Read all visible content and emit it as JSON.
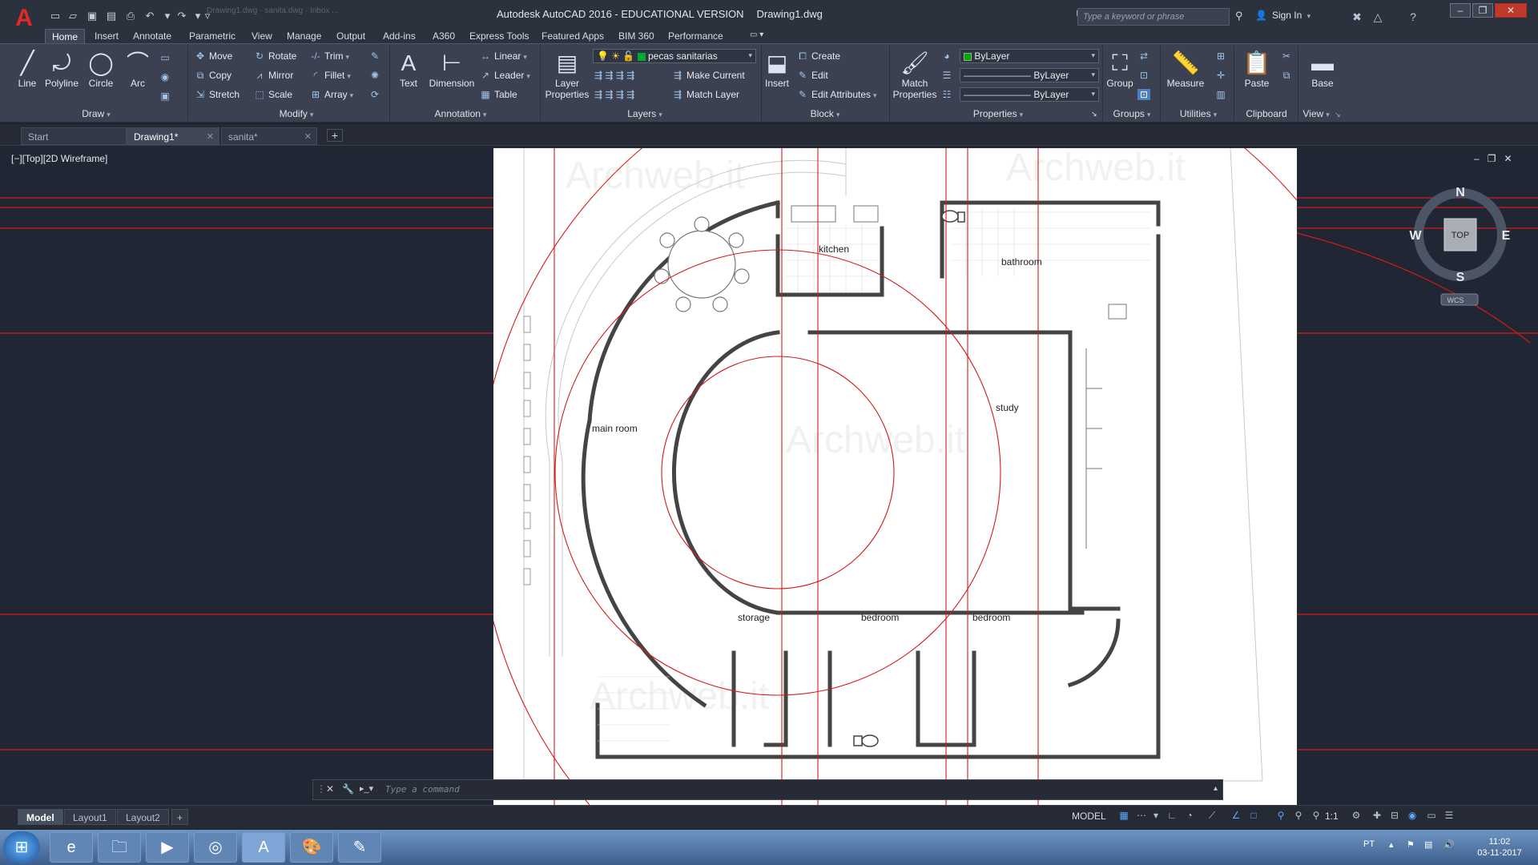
{
  "app": {
    "title": "Autodesk AutoCAD 2016 - EDUCATIONAL VERSION",
    "document": "Drawing1.dwg",
    "logo_letter": "A",
    "search_placeholder": "Type a keyword or phrase",
    "sign_in": "Sign In",
    "help": "?"
  },
  "ghost_tabs": "Drawing1.dwg  ·  sanita.dwg  ·  Inbox ...",
  "menu": [
    "Home",
    "Insert",
    "Annotate",
    "Parametric",
    "View",
    "Manage",
    "Output",
    "Add-ins",
    "A360",
    "Express Tools",
    "Featured Apps",
    "BIM 360",
    "Performance"
  ],
  "ribbon": {
    "draw": {
      "title": "Draw",
      "line": "Line",
      "polyline": "Polyline",
      "circle": "Circle",
      "arc": "Arc"
    },
    "modify": {
      "title": "Modify",
      "move": "Move",
      "rotate": "Rotate",
      "trim": "Trim",
      "copy": "Copy",
      "mirror": "Mirror",
      "fillet": "Fillet",
      "stretch": "Stretch",
      "scale": "Scale",
      "array": "Array"
    },
    "annotation": {
      "title": "Annotation",
      "text": "Text",
      "dimension": "Dimension",
      "linear": "Linear",
      "leader": "Leader",
      "table": "Table"
    },
    "layers": {
      "title": "Layers",
      "layer_properties": "Layer Properties",
      "current_layer": "pecas sanitarias",
      "make_current": "Make Current",
      "match_layer": "Match Layer"
    },
    "block": {
      "title": "Block",
      "insert": "Insert",
      "create": "Create",
      "edit": "Edit",
      "edit_attributes": "Edit Attributes"
    },
    "properties": {
      "title": "Properties",
      "match_properties": "Match Properties",
      "color": "ByLayer",
      "linetype": "ByLayer",
      "lineweight": "ByLayer"
    },
    "groups": {
      "title": "Groups",
      "group": "Group"
    },
    "utilities": {
      "title": "Utilities",
      "measure": "Measure"
    },
    "clipboard": {
      "title": "Clipboard",
      "paste": "Paste"
    },
    "view": {
      "title": "View",
      "base": "Base"
    }
  },
  "file_tabs": [
    {
      "label": "Start"
    },
    {
      "label": "Drawing1*"
    },
    {
      "label": "sanita*"
    }
  ],
  "viewport": {
    "label": "[−][Top][2D Wireframe]"
  },
  "viewcube": {
    "n": "N",
    "s": "S",
    "e": "E",
    "w": "W",
    "face": "TOP",
    "wcs": "WCS"
  },
  "drawing": {
    "rooms": [
      "kitchen",
      "bathroom",
      "main room",
      "study",
      "storage",
      "bedroom",
      "bedroom"
    ],
    "watermark": "Archweb.it"
  },
  "command": {
    "placeholder": "Type a command"
  },
  "layout_tabs": [
    "Model",
    "Layout1",
    "Layout2"
  ],
  "status": {
    "model": "MODEL",
    "scale": "1:1"
  },
  "taskbar": {
    "lang": "PT",
    "time": "11:02",
    "date": "03-11-2017"
  },
  "colors": {
    "accent": "#e02a2a",
    "ribbon_bg": "#3b4150",
    "canvas": "#212634",
    "construction": "#d61a1a"
  }
}
